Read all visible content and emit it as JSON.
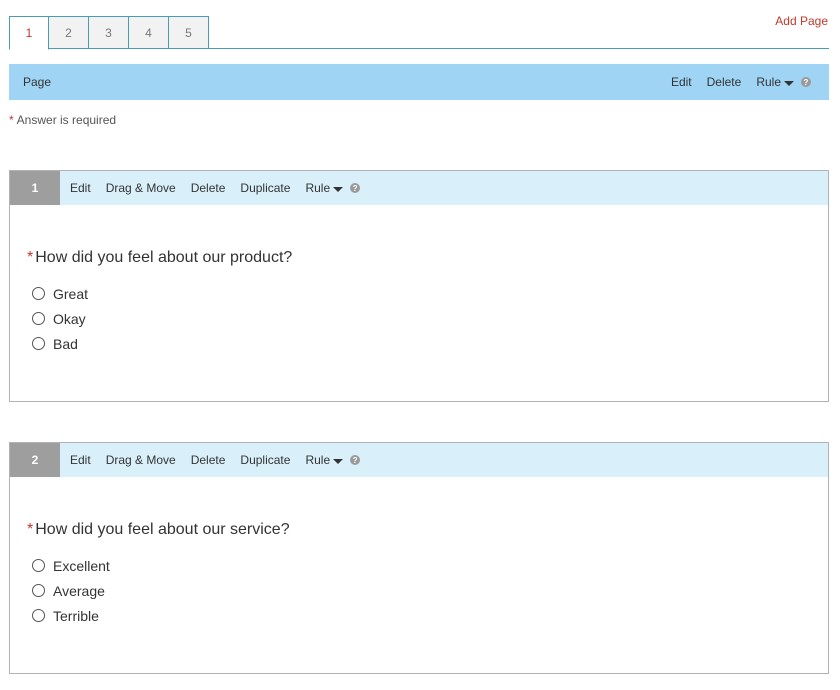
{
  "tabs": [
    {
      "label": "1",
      "active": true
    },
    {
      "label": "2",
      "active": false
    },
    {
      "label": "3",
      "active": false
    },
    {
      "label": "4",
      "active": false
    },
    {
      "label": "5",
      "active": false
    }
  ],
  "add_page_label": "Add Page",
  "page_bar": {
    "label": "Page",
    "edit": "Edit",
    "delete": "Delete",
    "rule": "Rule",
    "help": "?"
  },
  "required_note": {
    "star": "*",
    "text": "Answer is required"
  },
  "questions": [
    {
      "number": "1",
      "actions": {
        "edit": "Edit",
        "drag": "Drag & Move",
        "delete": "Delete",
        "duplicate": "Duplicate",
        "rule": "Rule",
        "help": "?"
      },
      "star": "*",
      "title": "How did you feel about our product?",
      "options": [
        "Great",
        "Okay",
        "Bad"
      ]
    },
    {
      "number": "2",
      "actions": {
        "edit": "Edit",
        "drag": "Drag & Move",
        "delete": "Delete",
        "duplicate": "Duplicate",
        "rule": "Rule",
        "help": "?"
      },
      "star": "*",
      "title": "How did you feel about our service?",
      "options": [
        "Excellent",
        "Average",
        "Terrible"
      ]
    }
  ],
  "colors": {
    "accent_red": "#c0392b",
    "page_bar_bg": "#9fd4f5",
    "question_header_bg": "#d9f0fb",
    "question_number_bg": "#9e9e9e",
    "tab_border": "#4a9bb5"
  }
}
